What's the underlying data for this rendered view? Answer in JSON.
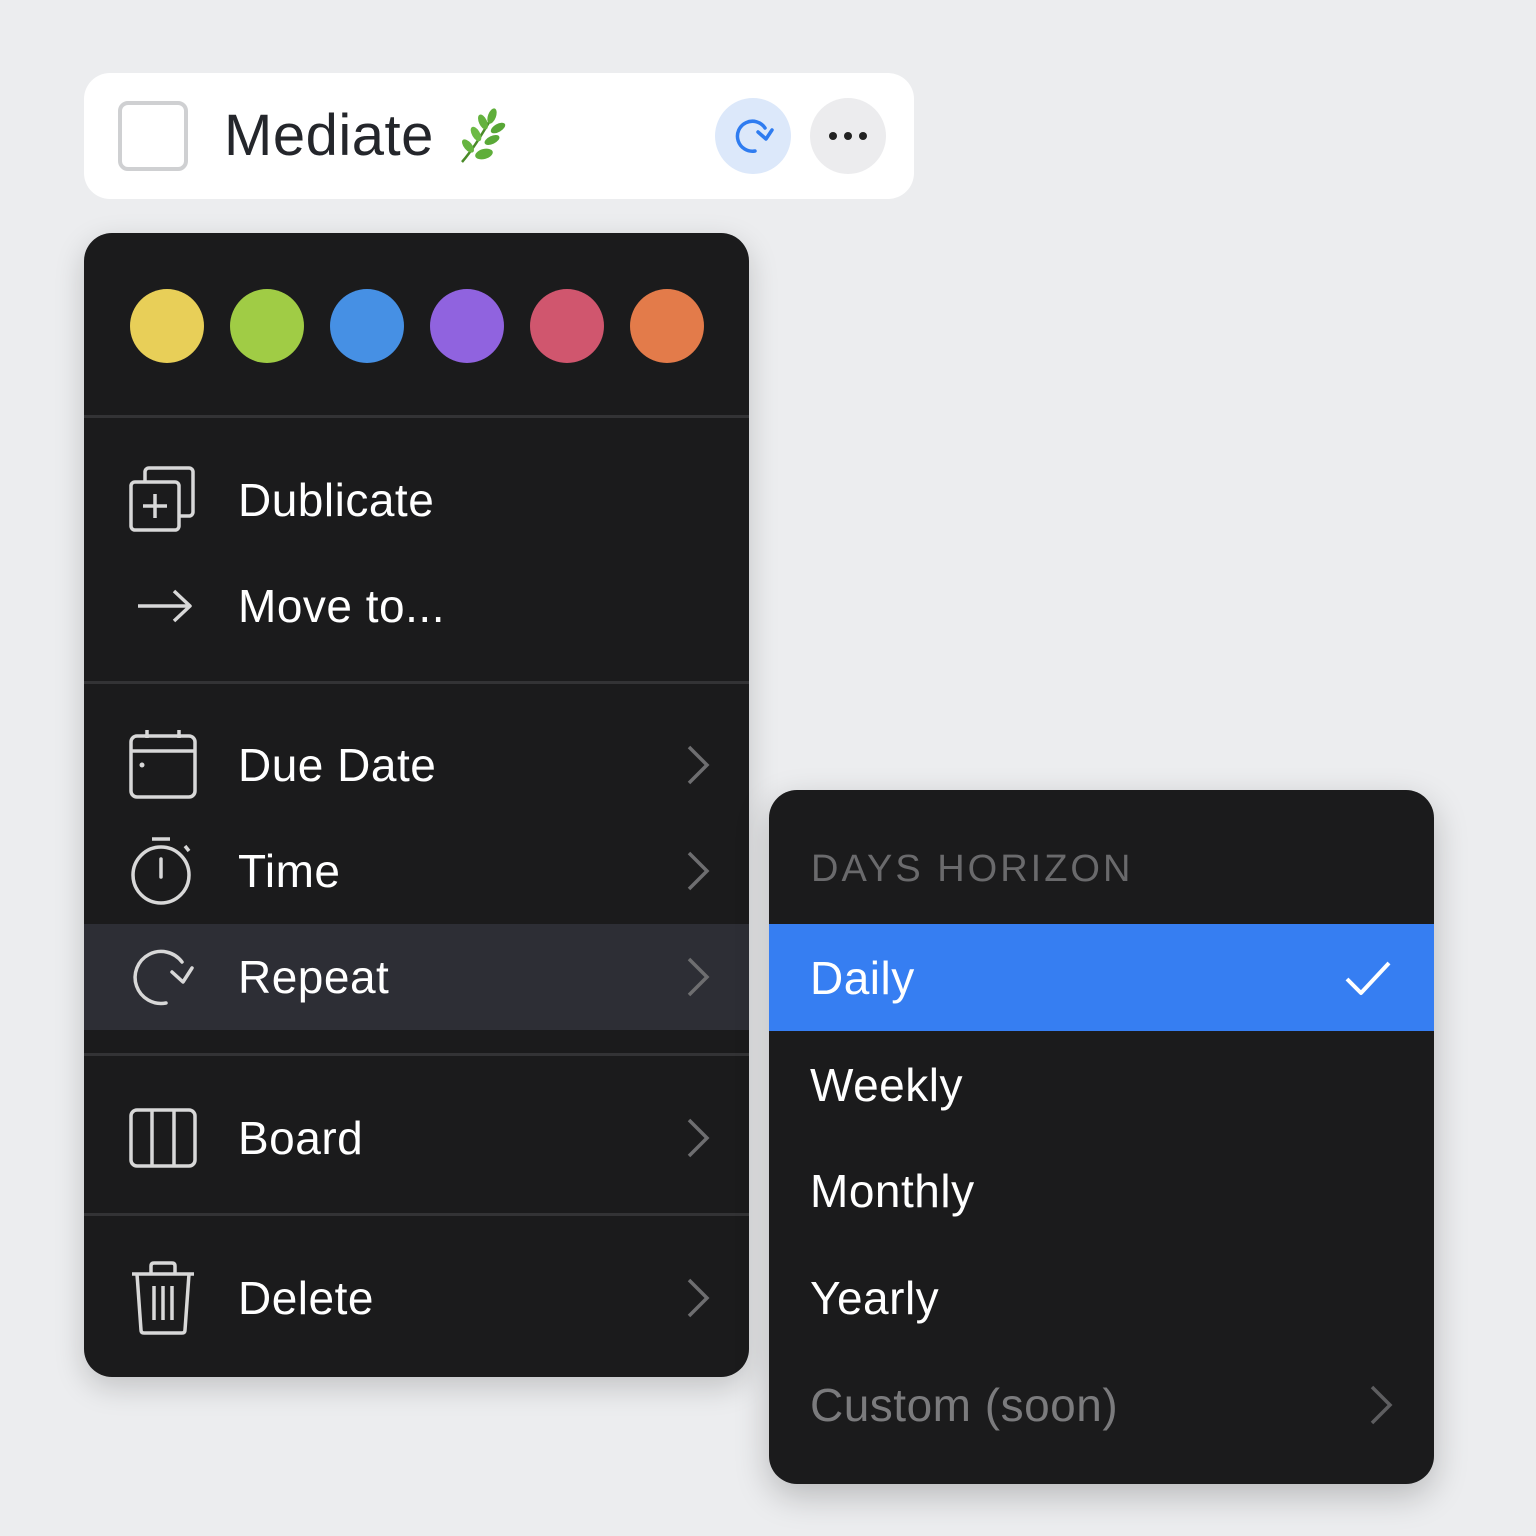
{
  "task": {
    "title": "Mediate",
    "emoji_icon": "herb-icon",
    "checked": false,
    "repeat_button_icon": "repeat-icon",
    "more_button_icon": "more-horizontal-icon"
  },
  "colors": {
    "page_background": "#ecedef",
    "menu_background": "#1b1b1c",
    "highlight_background": "#2d2e35",
    "selected_background": "#367ef2",
    "repeat_button_background": "#dce8fa",
    "repeat_icon_color": "#2f7cf0",
    "more_button_background": "#ececee"
  },
  "menu": {
    "swatches": [
      {
        "name": "yellow",
        "color": "#e8cf58"
      },
      {
        "name": "green",
        "color": "#a0cc45"
      },
      {
        "name": "blue",
        "color": "#4690e4"
      },
      {
        "name": "purple",
        "color": "#9063df"
      },
      {
        "name": "red",
        "color": "#d0566e"
      },
      {
        "name": "orange",
        "color": "#e37b4a"
      }
    ],
    "items": [
      {
        "label": "Dublicate",
        "icon": "duplicate-icon",
        "has_submenu": false
      },
      {
        "label": "Move to...",
        "icon": "arrow-right-icon",
        "has_submenu": false
      },
      {
        "label": "Due Date",
        "icon": "calendar-icon",
        "has_submenu": true
      },
      {
        "label": "Time",
        "icon": "stopwatch-icon",
        "has_submenu": true
      },
      {
        "label": "Repeat",
        "icon": "repeat-icon",
        "has_submenu": true,
        "highlighted": true
      },
      {
        "label": "Board",
        "icon": "board-columns-icon",
        "has_submenu": true
      },
      {
        "label": "Delete",
        "icon": "trash-icon",
        "has_submenu": true
      }
    ]
  },
  "submenu": {
    "header": "DAYS HORIZON",
    "items": [
      {
        "label": "Daily",
        "selected": true
      },
      {
        "label": "Weekly",
        "selected": false
      },
      {
        "label": "Monthly",
        "selected": false
      },
      {
        "label": "Yearly",
        "selected": false
      },
      {
        "label": "Custom (soon)",
        "selected": false,
        "disabled": true,
        "has_submenu": true
      }
    ]
  }
}
